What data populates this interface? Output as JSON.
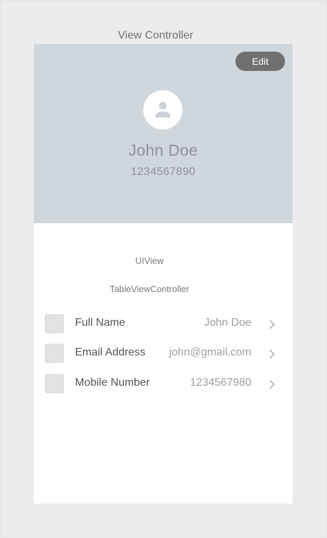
{
  "window": {
    "title": "View Controller"
  },
  "header": {
    "edit_label": "Edit",
    "name": "John Doe",
    "phone": "1234567890",
    "background_color": "#cfd6dc",
    "avatar_icon": "person-icon"
  },
  "labels": {
    "uiview": "UIView",
    "table_view_controller": "TableViewController"
  },
  "rows": [
    {
      "label": "Full Name",
      "value": "John Doe",
      "chevron_icon": "chevron-right-icon"
    },
    {
      "label": "Email Address",
      "value": "john@gmail.com",
      "chevron_icon": "chevron-right-icon"
    },
    {
      "label": "Mobile Number",
      "value": "1234567980",
      "chevron_icon": "chevron-right-icon"
    }
  ]
}
